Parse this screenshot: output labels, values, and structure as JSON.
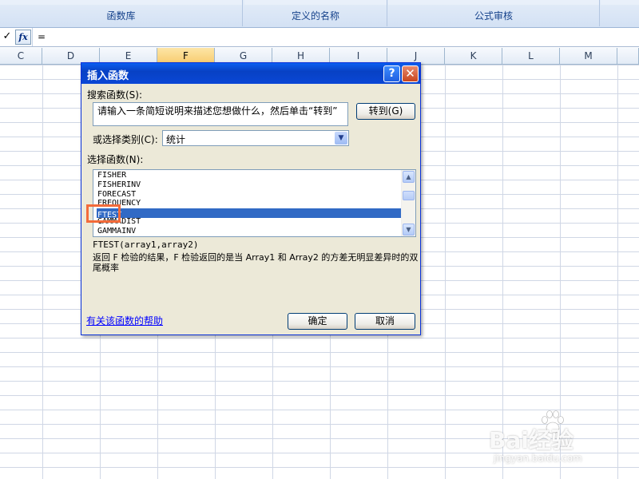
{
  "ribbon": {
    "groups": [
      {
        "label": "函数库"
      },
      {
        "label": "定义的名称"
      },
      {
        "label": "公式审核"
      },
      {
        "label": ""
      }
    ]
  },
  "formula_bar": {
    "check_icon": "check-icon",
    "fx_label": "fx",
    "content": "="
  },
  "sheet": {
    "columns": [
      "C",
      "D",
      "E",
      "F",
      "G",
      "H",
      "I",
      "J",
      "K",
      "L",
      "M"
    ],
    "selected_column": "F",
    "selected_header_color": "#f8cc6e",
    "gridline_color": "#d0d7e5"
  },
  "dialog": {
    "title": "插入函数",
    "help_icon": "?",
    "close_icon": "✕",
    "search_label": "搜索函数(S):",
    "search_value": "请输入一条简短说明来描述您想做什么，然后单击“转到”",
    "goto_button": "转到(G)",
    "category_label": "或选择类别(C):",
    "category_value": "统计",
    "list_label": "选择函数(N):",
    "functions": [
      "FISHER",
      "FISHERINV",
      "FORECAST",
      "FREQUENCY",
      "FTEST",
      "GAMMADIST",
      "GAMMAINV"
    ],
    "selected_function": "FTEST",
    "signature": "FTEST(array1,array2)",
    "description": "返回 F 检验的结果，F 检验返回的是当 Array1 和 Array2 的方差无明显差异时的双尾概率",
    "help_link": "有关该函数的帮助",
    "ok_button": "确定",
    "cancel_button": "取消",
    "title_color": "#0a5ef0",
    "highlight_color": "#f36b3a"
  },
  "watermark": {
    "brand": "Bai经验",
    "url": "jingyan.baidu.com"
  }
}
